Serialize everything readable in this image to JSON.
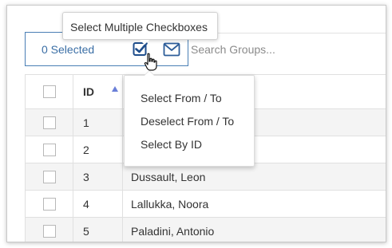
{
  "toolbar": {
    "selected_count_label": "0 Selected",
    "check_icon": "checkbox-check-icon",
    "mail_icon": "envelope-icon",
    "search_placeholder": "Search Groups..."
  },
  "tooltip": {
    "text": "Select Multiple Checkboxes"
  },
  "menu": {
    "items": [
      {
        "label": "Select From / To"
      },
      {
        "label": "Deselect From / To"
      },
      {
        "label": "Select By ID"
      }
    ]
  },
  "table": {
    "headers": {
      "id": "ID",
      "sort": "ascending"
    },
    "rows": [
      {
        "id": "1",
        "name": ""
      },
      {
        "id": "2",
        "name": ""
      },
      {
        "id": "3",
        "name": "Dussault, Leon"
      },
      {
        "id": "4",
        "name": "Lallukka, Noora"
      },
      {
        "id": "5",
        "name": "Paladini, Antonio"
      }
    ]
  },
  "colors": {
    "accent": "#3a6ea5",
    "border": "#4a7fb5",
    "sort_arrow": "#6a7fd8",
    "row_shade": "#f4f4f4"
  }
}
